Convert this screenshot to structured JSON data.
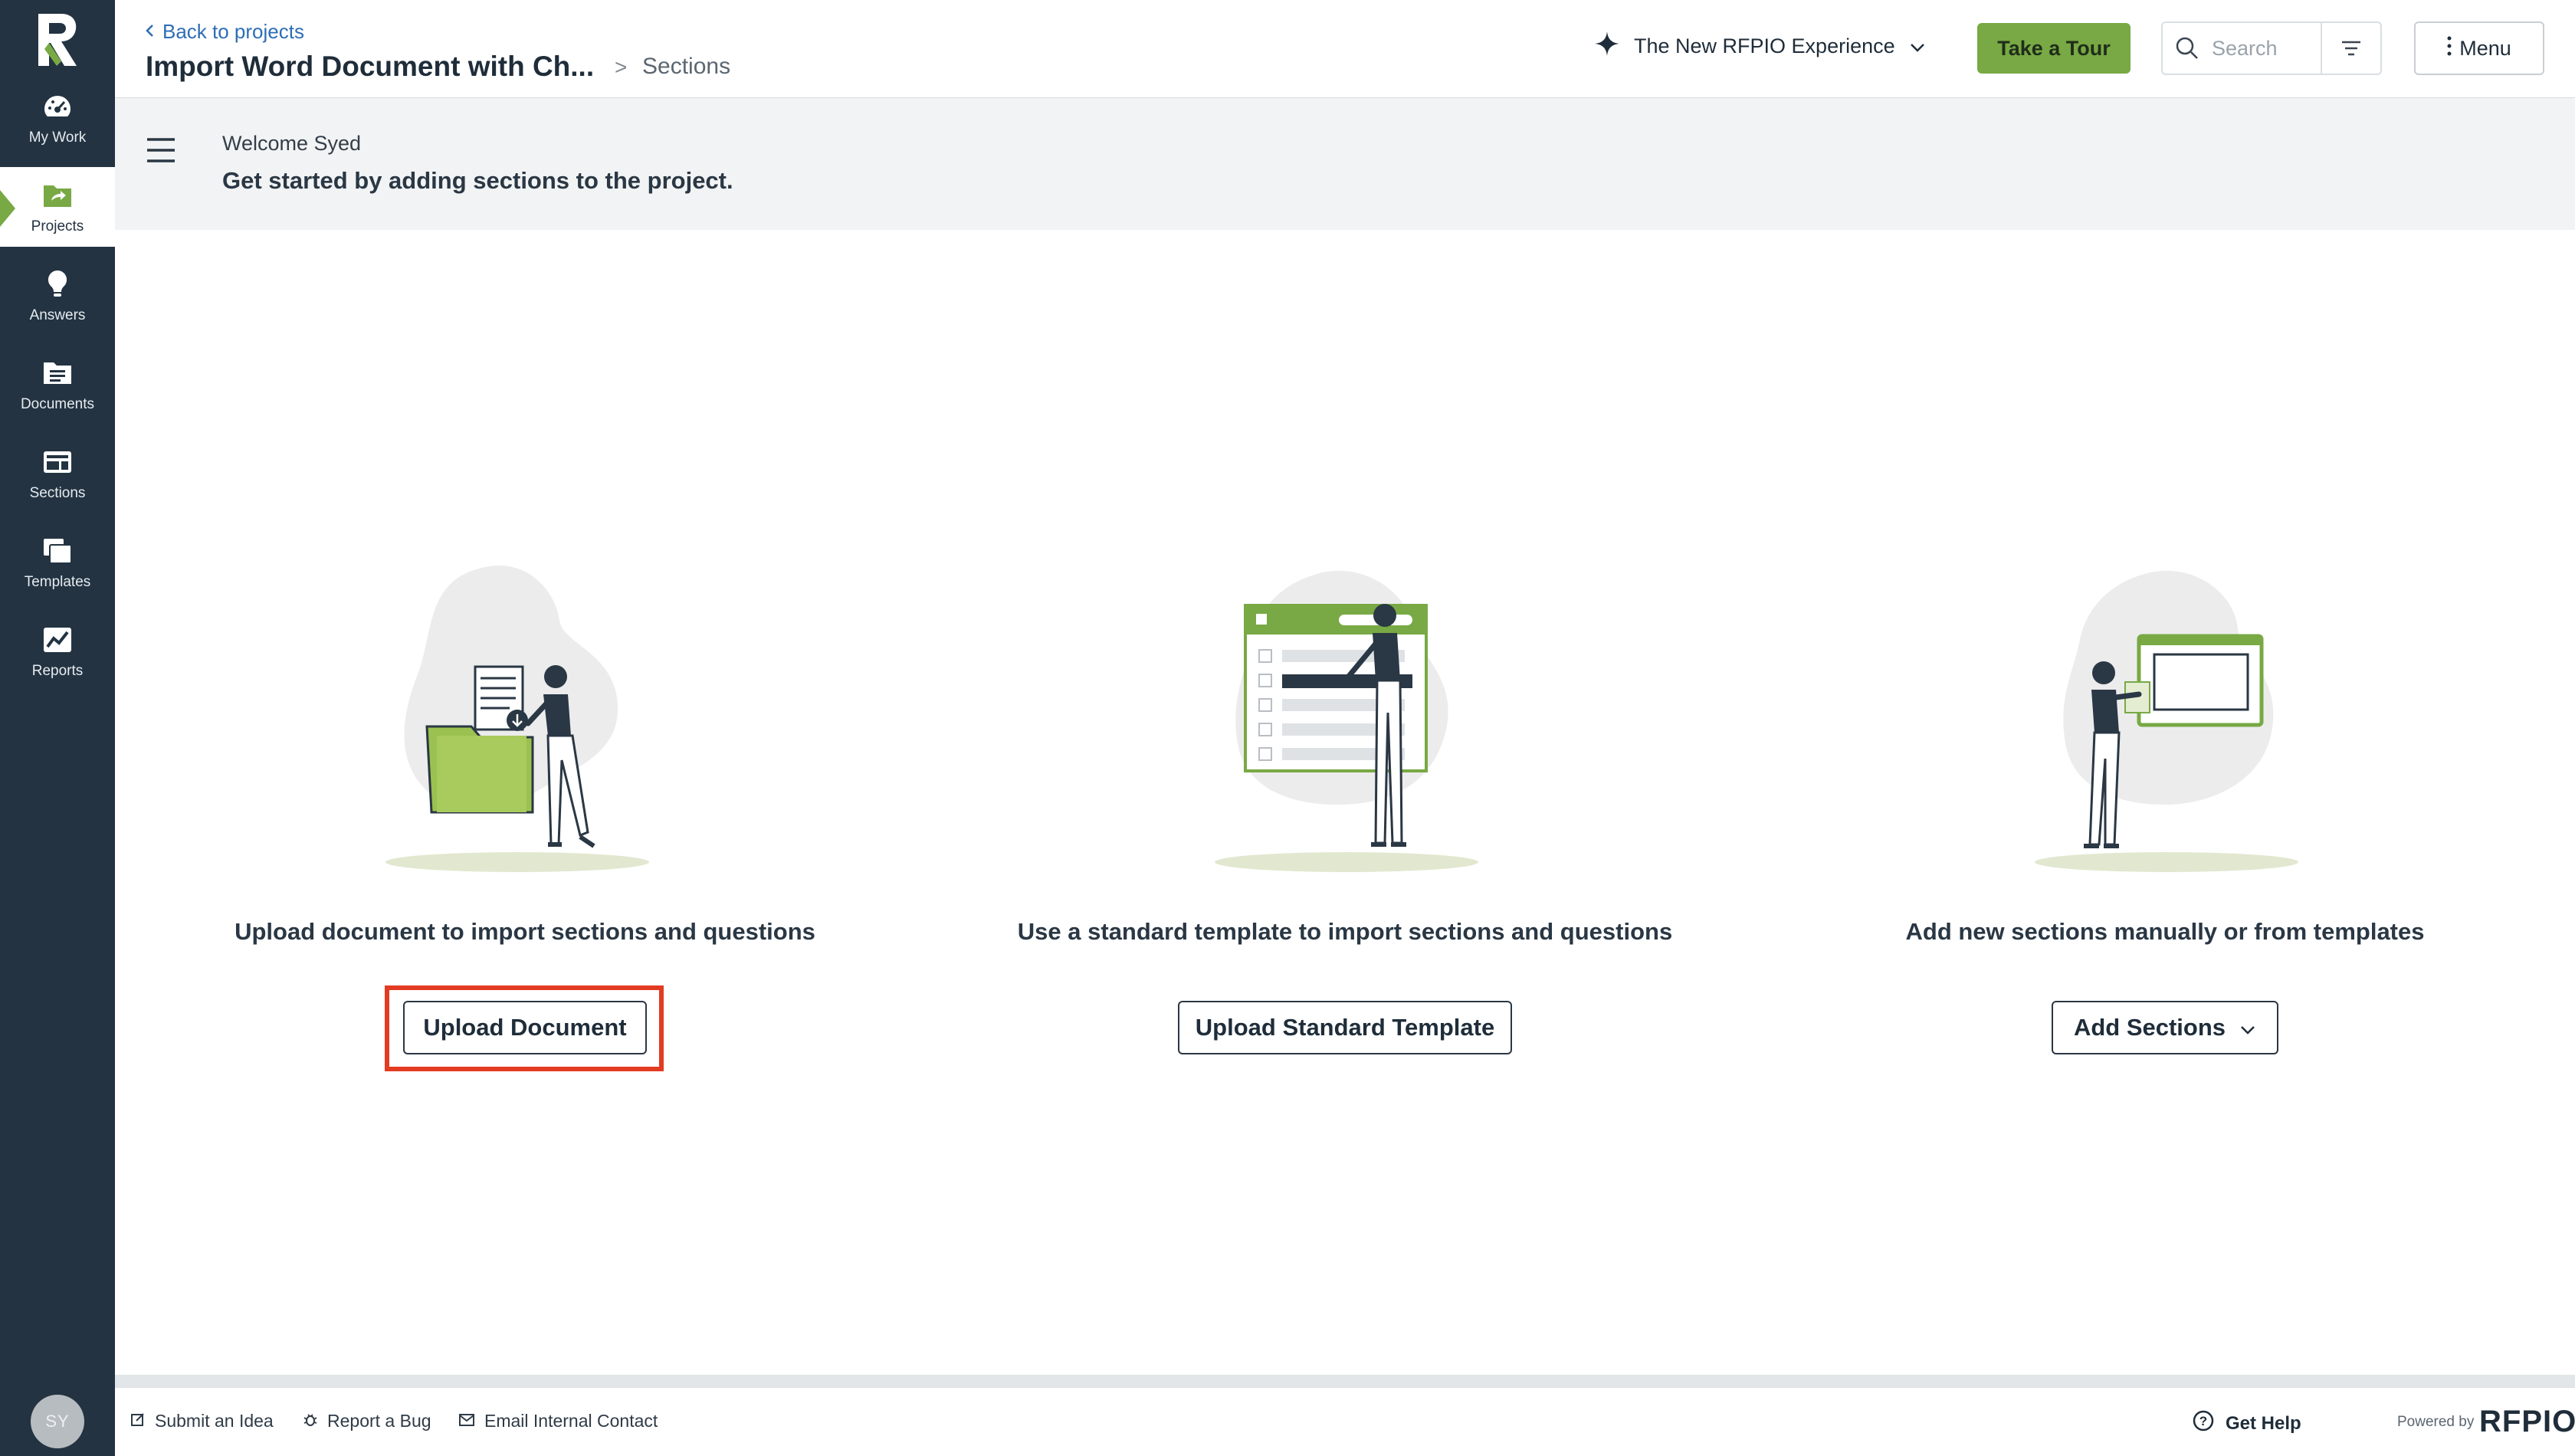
{
  "sidebar": {
    "items": [
      {
        "label": "My Work",
        "icon": "dashboard-icon"
      },
      {
        "label": "Projects",
        "icon": "projects-folder-icon"
      },
      {
        "label": "Answers",
        "icon": "lightbulb-icon"
      },
      {
        "label": "Documents",
        "icon": "documents-icon"
      },
      {
        "label": "Sections",
        "icon": "sections-icon"
      },
      {
        "label": "Templates",
        "icon": "templates-icon"
      },
      {
        "label": "Reports",
        "icon": "reports-icon"
      }
    ],
    "active_item": "Projects",
    "avatar_initials": "SY"
  },
  "header": {
    "back_link": "Back to projects",
    "project_title": "Import Word Document with Ch...",
    "breadcrumb_separator": ">",
    "breadcrumb_current": "Sections",
    "experience_label": "The New RFPIO Experience",
    "tour_button": "Take a Tour",
    "search_placeholder": "Search",
    "menu_button": "Menu"
  },
  "welcome": {
    "name_line": "Welcome Syed",
    "message": "Get started by adding sections to the project."
  },
  "cards": [
    {
      "text": "Upload document to import sections and questions",
      "button": "Upload Document",
      "highlighted": true
    },
    {
      "text": "Use a standard template to import sections and questions",
      "button": "Upload Standard Template",
      "highlighted": false
    },
    {
      "text": "Add new sections manually or from templates",
      "button": "Add Sections",
      "highlighted": false
    }
  ],
  "footer": {
    "submit_idea": "Submit an Idea",
    "report_bug": "Report a Bug",
    "email_contact": "Email Internal Contact",
    "get_help": "Get Help",
    "powered_by": "Powered by",
    "brand": "RFPIO"
  },
  "colors": {
    "sidebar_bg": "#233342",
    "accent_green": "#78a944",
    "highlight_red": "#e23b22",
    "link_blue": "#2d6db5"
  }
}
